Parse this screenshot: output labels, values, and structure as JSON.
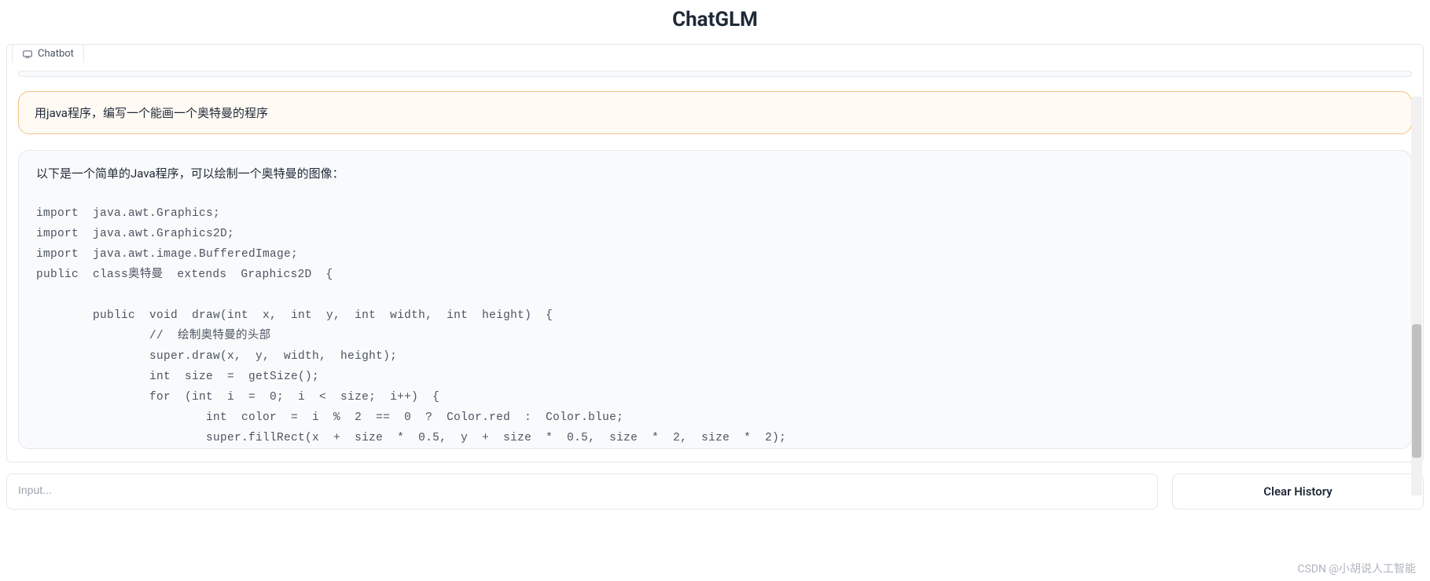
{
  "header": {
    "title": "ChatGLM"
  },
  "tab": {
    "label": "Chatbot",
    "icon": "chat-icon"
  },
  "conversation": {
    "user_message": "用java程序，编写一个能画一个奥特曼的程序",
    "bot_intro": "以下是一个简单的Java程序，可以绘制一个奥特曼的图像：",
    "code": "import  java.awt.Graphics;\nimport  java.awt.Graphics2D;\nimport  java.awt.image.BufferedImage;\npublic  class奥特曼  extends  Graphics2D  {\n\n        public  void  draw(int  x,  int  y,  int  width,  int  height)  {\n                //  绘制奥特曼的头部\n                super.draw(x,  y,  width,  height);\n                int  size  =  getSize();\n                for  (int  i  =  0;  i  <  size;  i++)  {\n                        int  color  =  i  %  2  ==  0  ?  Color.red  :  Color.blue;\n                        super.fillRect(x  +  size  *  0.5,  y  +  size  *  0.5,  size  *  2,  size  *  2);"
  },
  "input": {
    "placeholder": "Input..."
  },
  "buttons": {
    "clear_label": "Clear History"
  },
  "watermark": "CSDN @小胡说人工智能"
}
